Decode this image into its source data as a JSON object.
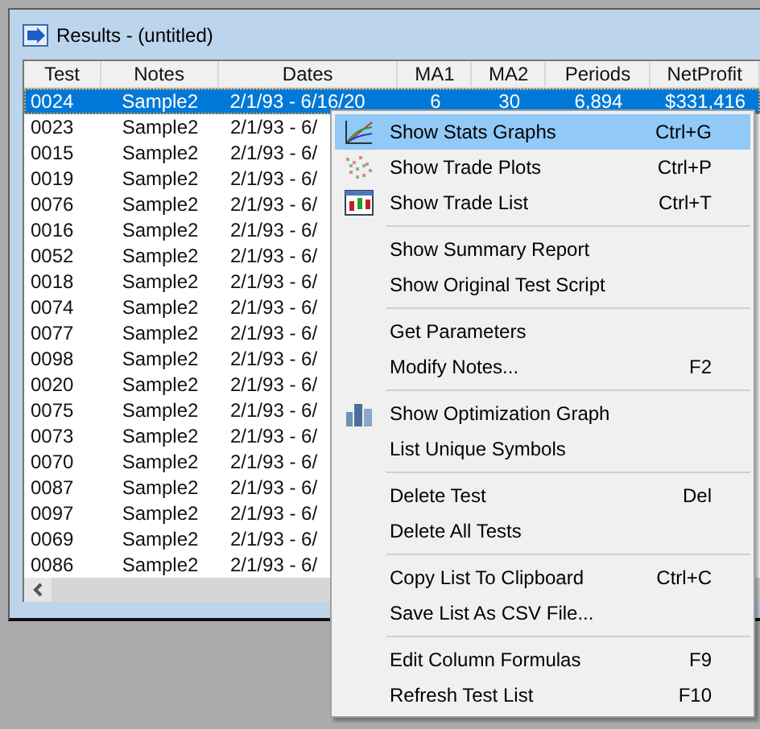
{
  "window": {
    "title": "Results - (untitled)"
  },
  "table": {
    "columns": [
      "Test",
      "Notes",
      "Dates",
      "MA1",
      "MA2",
      "Periods",
      "NetProfit"
    ],
    "rows": [
      {
        "selected": true,
        "cells": [
          "0024",
          "Sample2",
          "2/1/93 - 6/16/20",
          "6",
          "30",
          "6,894",
          "$331,416"
        ]
      },
      {
        "selected": false,
        "cells": [
          "0023",
          "Sample2",
          "2/1/93 - 6/"
        ]
      },
      {
        "selected": false,
        "cells": [
          "0015",
          "Sample2",
          "2/1/93 - 6/"
        ]
      },
      {
        "selected": false,
        "cells": [
          "0019",
          "Sample2",
          "2/1/93 - 6/"
        ]
      },
      {
        "selected": false,
        "cells": [
          "0076",
          "Sample2",
          "2/1/93 - 6/"
        ]
      },
      {
        "selected": false,
        "cells": [
          "0016",
          "Sample2",
          "2/1/93 - 6/"
        ]
      },
      {
        "selected": false,
        "cells": [
          "0052",
          "Sample2",
          "2/1/93 - 6/"
        ]
      },
      {
        "selected": false,
        "cells": [
          "0018",
          "Sample2",
          "2/1/93 - 6/"
        ]
      },
      {
        "selected": false,
        "cells": [
          "0074",
          "Sample2",
          "2/1/93 - 6/"
        ]
      },
      {
        "selected": false,
        "cells": [
          "0077",
          "Sample2",
          "2/1/93 - 6/"
        ]
      },
      {
        "selected": false,
        "cells": [
          "0098",
          "Sample2",
          "2/1/93 - 6/"
        ]
      },
      {
        "selected": false,
        "cells": [
          "0020",
          "Sample2",
          "2/1/93 - 6/"
        ]
      },
      {
        "selected": false,
        "cells": [
          "0075",
          "Sample2",
          "2/1/93 - 6/"
        ]
      },
      {
        "selected": false,
        "cells": [
          "0073",
          "Sample2",
          "2/1/93 - 6/"
        ]
      },
      {
        "selected": false,
        "cells": [
          "0070",
          "Sample2",
          "2/1/93 - 6/"
        ]
      },
      {
        "selected": false,
        "cells": [
          "0087",
          "Sample2",
          "2/1/93 - 6/"
        ]
      },
      {
        "selected": false,
        "cells": [
          "0097",
          "Sample2",
          "2/1/93 - 6/"
        ]
      },
      {
        "selected": false,
        "cells": [
          "0069",
          "Sample2",
          "2/1/93 - 6/"
        ]
      },
      {
        "selected": false,
        "cells": [
          "0086",
          "Sample2",
          "2/1/93 - 6/"
        ]
      }
    ]
  },
  "context_menu": {
    "items": [
      {
        "kind": "graph",
        "label": "Show Stats Graphs",
        "shortcut": "Ctrl+G",
        "selected": true
      },
      {
        "kind": "plot",
        "label": "Show Trade Plots",
        "shortcut": "Ctrl+P",
        "selected": false
      },
      {
        "kind": "list",
        "label": "Show Trade List",
        "shortcut": "Ctrl+T",
        "selected": false
      },
      {
        "kind": "separator"
      },
      {
        "kind": "plain",
        "label": "Show Summary Report",
        "selected": false
      },
      {
        "kind": "plain",
        "label": "Show Original Test Script",
        "selected": false
      },
      {
        "kind": "separator"
      },
      {
        "kind": "plain",
        "label": "Get Parameters",
        "selected": false
      },
      {
        "kind": "plain",
        "label": "Modify Notes...",
        "shortcut": "F2",
        "selected": false
      },
      {
        "kind": "separator"
      },
      {
        "kind": "optimization",
        "label": "Show Optimization Graph",
        "selected": false
      },
      {
        "kind": "plain",
        "label": "List Unique Symbols",
        "selected": false
      },
      {
        "kind": "separator"
      },
      {
        "kind": "plain",
        "label": "Delete Test",
        "shortcut": "Del",
        "selected": false
      },
      {
        "kind": "plain",
        "label": "Delete All Tests",
        "selected": false
      },
      {
        "kind": "separator"
      },
      {
        "kind": "plain",
        "label": "Copy List To Clipboard",
        "shortcut": "Ctrl+C",
        "selected": false
      },
      {
        "kind": "plain",
        "label": "Save List As CSV File...",
        "selected": false
      },
      {
        "kind": "separator"
      },
      {
        "kind": "plain",
        "label": "Edit Column Formulas",
        "shortcut": "F9",
        "selected": false
      },
      {
        "kind": "plain",
        "label": "Refresh Test List",
        "shortcut": "F10",
        "selected": false
      }
    ]
  }
}
